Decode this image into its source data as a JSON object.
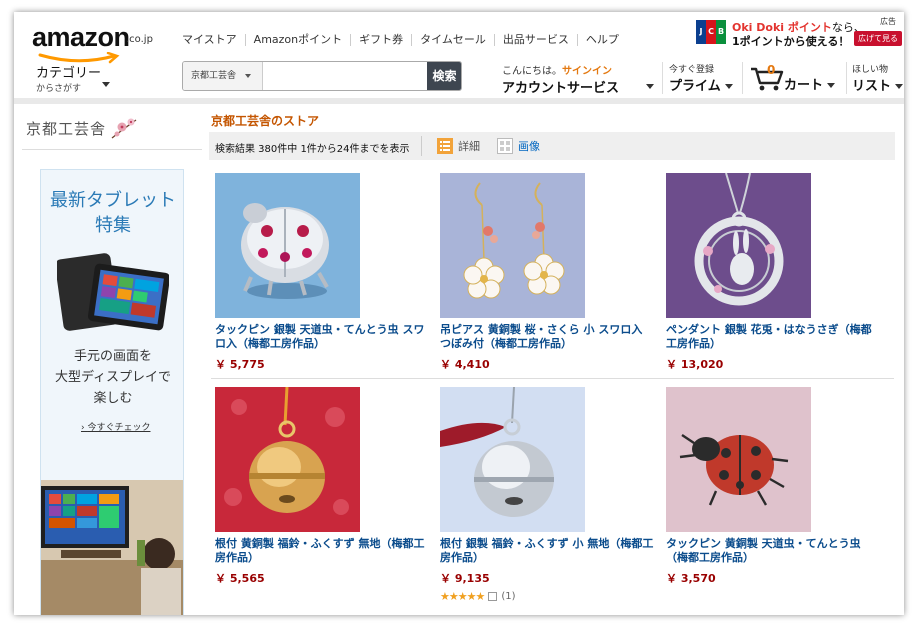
{
  "header": {
    "logo_text": "amazon",
    "logo_tld": ".co.jp",
    "links": [
      "マイストア",
      "Amazonポイント",
      "ギフト券",
      "タイムセール",
      "出品サービス",
      "ヘルプ"
    ],
    "ad": {
      "line1_brand": "Oki Doki ポイント",
      "line1_suffix": "なら、",
      "line2": "1ポイントから使える！",
      "tag": "広告",
      "button": "広げて見る"
    },
    "category": {
      "label": "カテゴリー",
      "sub": "からさがす"
    },
    "search": {
      "dropdown": "京都工芸舎",
      "value": "",
      "button": "検索"
    },
    "account": {
      "greeting": "こんにちは。",
      "signin": "サインイン",
      "label": "アカウントサービス"
    },
    "prime": {
      "sub": "今すぐ登録",
      "label": "プライム"
    },
    "cart": {
      "count": "0",
      "label": "カート"
    },
    "wishlist": {
      "sub": "ほしい物",
      "label": "リスト"
    }
  },
  "sidebar": {
    "store_logo": "京都工芸舎",
    "ad": {
      "heading_line1": "最新タブレット",
      "heading_line2": "特集",
      "body_line1": "手元の画面を",
      "body_line2": "大型ディスプレイで",
      "body_line3": "楽しむ",
      "cta": "今すぐチェック"
    }
  },
  "main": {
    "store_title": "京都工芸舎のストア",
    "results_text": "検索結果 380件中 1件から24件までを表示",
    "view_detail": "詳細",
    "view_image": "画像",
    "items": [
      {
        "name": "タックピン 銀製 天道虫・てんとう虫 スワロ入（梅都工房作品）",
        "price": "￥ 5,775"
      },
      {
        "name": "吊ピアス 黄銅製 桜・さくら 小 スワロ入 つぼみ付（梅都工房作品）",
        "price": "￥ 4,410"
      },
      {
        "name": "ペンダント 銀製 花兎・はなうさぎ（梅都工房作品）",
        "price": "￥ 13,020"
      },
      {
        "name": "根付 黄銅製 福鈴・ふくすず 無地（梅都工房作品）",
        "price": "￥ 5,565"
      },
      {
        "name": "根付 銀製 福鈴・ふくすず 小 無地（梅都工房作品）",
        "price": "￥ 9,135",
        "stars": "★★★★★",
        "rating": 5,
        "review_count": "(1)"
      },
      {
        "name": "タックピン 黄銅製 天道虫・てんとう虫（梅都工房作品）",
        "price": "￥ 3,570"
      }
    ]
  },
  "colors": {
    "brand_orange": "#e47911",
    "link_blue": "#0b4c8c",
    "price_red": "#990000",
    "store_title": "#c45500"
  }
}
